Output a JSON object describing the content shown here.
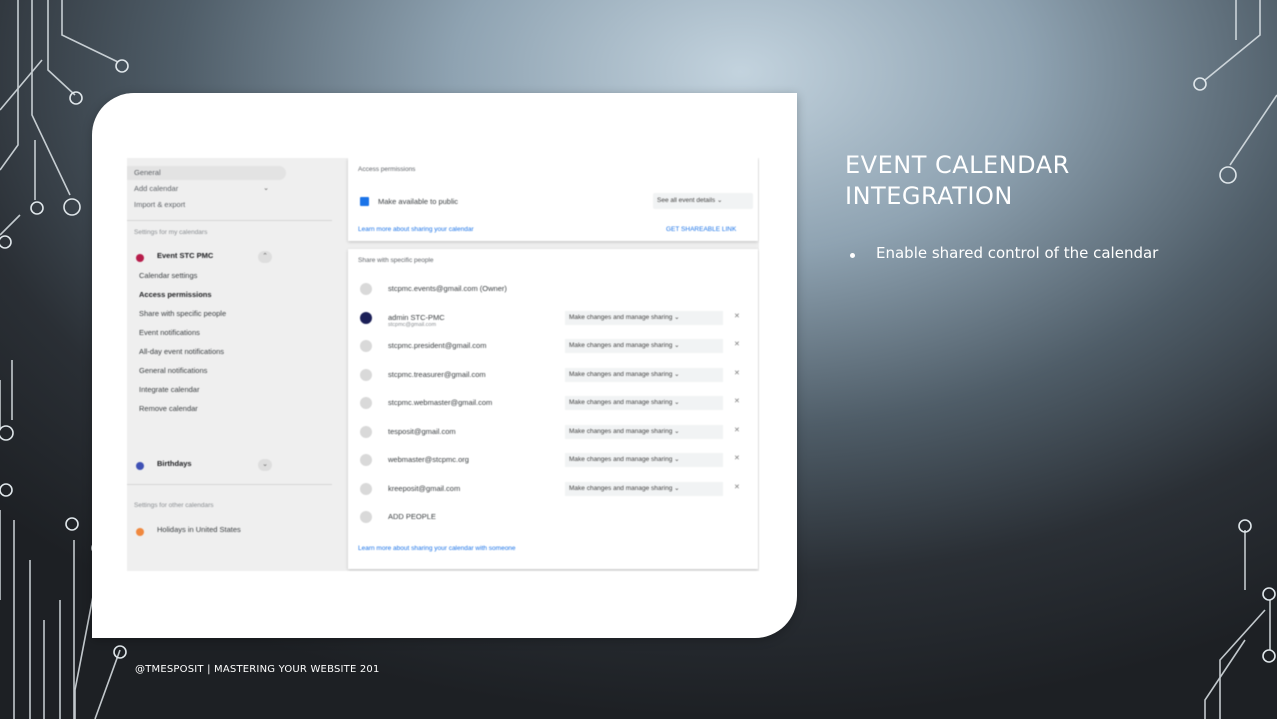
{
  "slide": {
    "title": "EVENT CALENDAR\nINTEGRATION",
    "bullets": [
      "Enable shared control of the calendar"
    ],
    "footer": "@TMESPOSIT | MASTERING YOUR WEBSITE 201",
    "colors": {
      "background_dark": "#1d2024",
      "background_light": "#c3d3de",
      "text": "#ffffff",
      "circuit_line": "#dfe6ea"
    }
  },
  "screenshot": {
    "sidebar": {
      "top_items": [
        "General",
        "Add calendar",
        "Import & export"
      ],
      "section_my_calendars": "Settings for my calendars",
      "calendars": [
        {
          "name": "Event STC PMC",
          "color": "#b71c4a"
        },
        {
          "name": "Birthdays",
          "color": "#3f51b5"
        }
      ],
      "sub_items": [
        "Calendar settings",
        "Access permissions",
        "Share with specific people",
        "Event notifications",
        "All-day event notifications",
        "General notifications",
        "Integrate calendar",
        "Remove calendar"
      ],
      "section_other_calendars": "Settings for other calendars",
      "other_calendars": [
        {
          "name": "Holidays in United States",
          "color": "#f0883e"
        }
      ]
    },
    "access_permissions": {
      "title": "Access permissions",
      "make_public_label": "Make available to public",
      "visibility_value": "See all event details",
      "learn_more": "Learn more about sharing your calendar",
      "shareable_link": "GET SHAREABLE LINK"
    },
    "share_specific": {
      "title": "Share with specific people",
      "rows": [
        {
          "email": "stcpmc.events@gmail.com (Owner)",
          "sub": "",
          "permission": "",
          "dark": false
        },
        {
          "email": "admin STC-PMC",
          "sub": "stcpmc@gmail.com",
          "permission": "Make changes and manage sharing",
          "dark": true
        },
        {
          "email": "stcpmc.president@gmail.com",
          "sub": "",
          "permission": "Make changes and manage sharing",
          "dark": false
        },
        {
          "email": "stcpmc.treasurer@gmail.com",
          "sub": "",
          "permission": "Make changes and manage sharing",
          "dark": false
        },
        {
          "email": "stcpmc.webmaster@gmail.com",
          "sub": "",
          "permission": "Make changes and manage sharing",
          "dark": false
        },
        {
          "email": "tesposit@gmail.com",
          "sub": "",
          "permission": "Make changes and manage sharing",
          "dark": false
        },
        {
          "email": "webmaster@stcpmc.org",
          "sub": "",
          "permission": "Make changes and manage sharing",
          "dark": false
        },
        {
          "email": "kreeposit@gmail.com",
          "sub": "",
          "permission": "Make changes and manage sharing",
          "dark": false
        },
        {
          "email": "ADD PEOPLE",
          "sub": "",
          "permission": "",
          "dark": false
        }
      ],
      "learn_more": "Learn more about sharing your calendar with someone"
    }
  }
}
